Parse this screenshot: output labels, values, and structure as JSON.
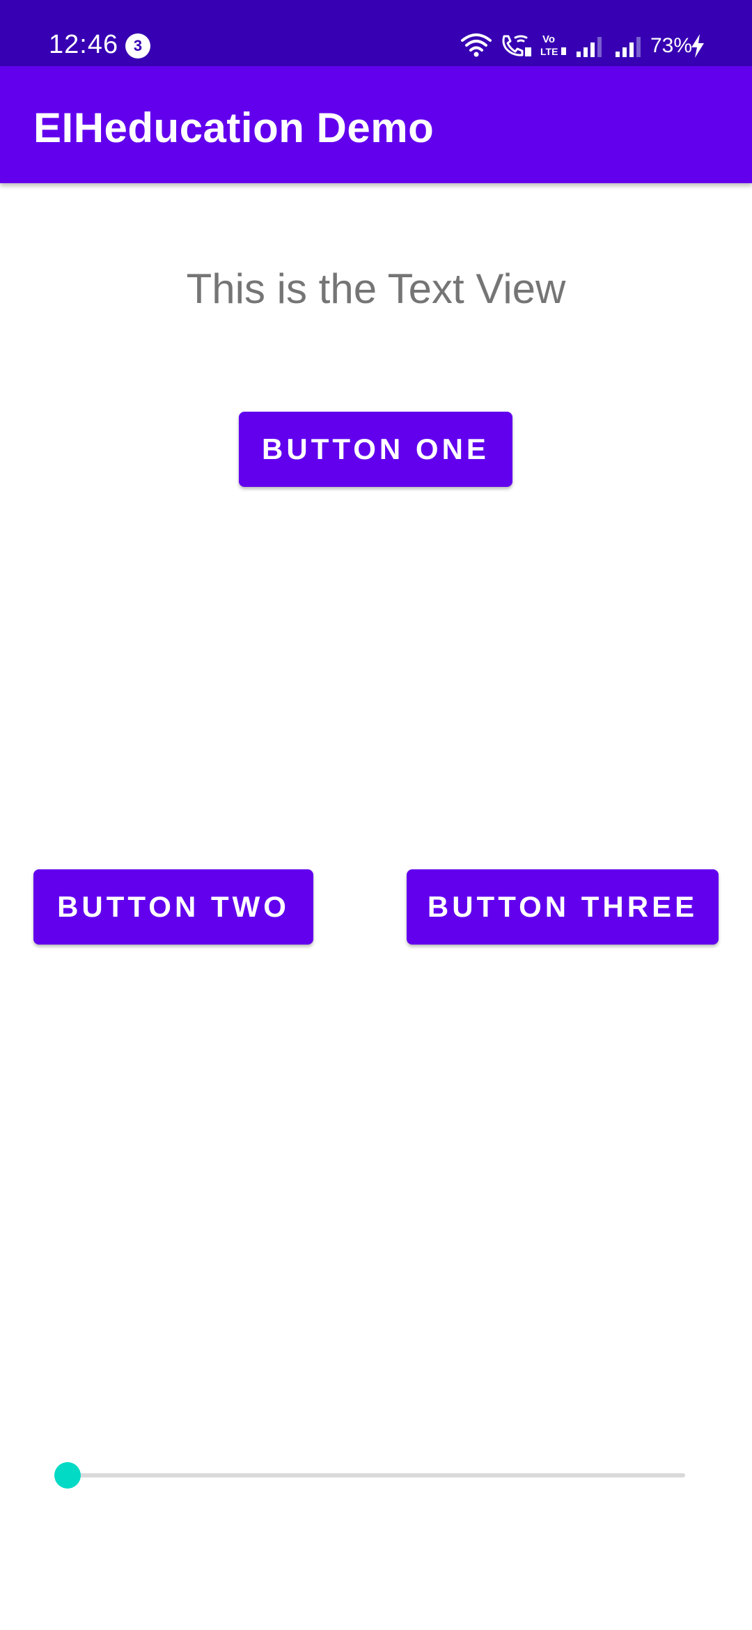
{
  "status_bar": {
    "time": "12:46",
    "notification_count": "3",
    "battery_percent": "73%",
    "icons": [
      "wifi-icon",
      "wifi-call-icon",
      "volte-icon",
      "signal-icon",
      "signal-icon",
      "charging-icon"
    ],
    "colors": {
      "background": "#3700B3"
    }
  },
  "app_bar": {
    "title": "EIHeducation Demo",
    "colors": {
      "background": "#6200EE"
    }
  },
  "main": {
    "text_view": "This is the Text View",
    "button_one_label": "BUTTON ONE",
    "button_two_label": "BUTTON TWO",
    "button_three_label": "BUTTON THREE",
    "seekbar_progress": 0,
    "colors": {
      "button": "#6200EE",
      "thumb": "#03DAC5",
      "track": "#D9D9D9",
      "text": "#757575"
    }
  }
}
